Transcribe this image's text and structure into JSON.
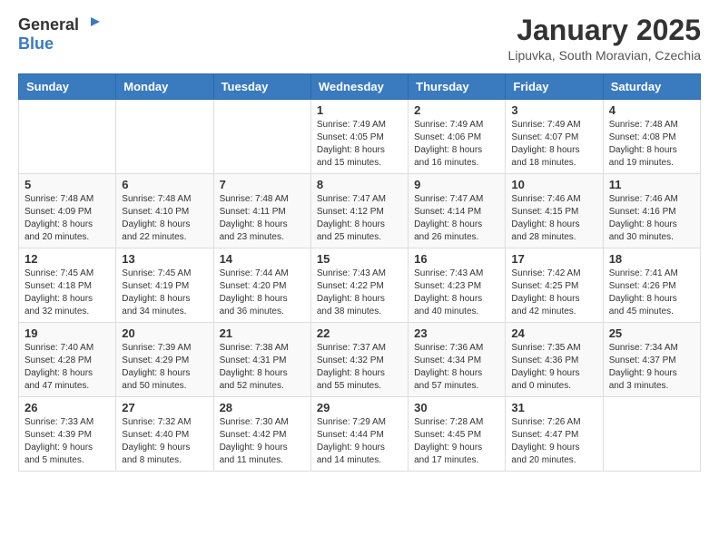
{
  "header": {
    "logo_general": "General",
    "logo_blue": "Blue",
    "month_title": "January 2025",
    "location": "Lipuvka, South Moravian, Czechia"
  },
  "days_of_week": [
    "Sunday",
    "Monday",
    "Tuesday",
    "Wednesday",
    "Thursday",
    "Friday",
    "Saturday"
  ],
  "weeks": [
    [
      {
        "num": "",
        "info": ""
      },
      {
        "num": "",
        "info": ""
      },
      {
        "num": "",
        "info": ""
      },
      {
        "num": "1",
        "info": "Sunrise: 7:49 AM\nSunset: 4:05 PM\nDaylight: 8 hours\nand 15 minutes."
      },
      {
        "num": "2",
        "info": "Sunrise: 7:49 AM\nSunset: 4:06 PM\nDaylight: 8 hours\nand 16 minutes."
      },
      {
        "num": "3",
        "info": "Sunrise: 7:49 AM\nSunset: 4:07 PM\nDaylight: 8 hours\nand 18 minutes."
      },
      {
        "num": "4",
        "info": "Sunrise: 7:48 AM\nSunset: 4:08 PM\nDaylight: 8 hours\nand 19 minutes."
      }
    ],
    [
      {
        "num": "5",
        "info": "Sunrise: 7:48 AM\nSunset: 4:09 PM\nDaylight: 8 hours\nand 20 minutes."
      },
      {
        "num": "6",
        "info": "Sunrise: 7:48 AM\nSunset: 4:10 PM\nDaylight: 8 hours\nand 22 minutes."
      },
      {
        "num": "7",
        "info": "Sunrise: 7:48 AM\nSunset: 4:11 PM\nDaylight: 8 hours\nand 23 minutes."
      },
      {
        "num": "8",
        "info": "Sunrise: 7:47 AM\nSunset: 4:12 PM\nDaylight: 8 hours\nand 25 minutes."
      },
      {
        "num": "9",
        "info": "Sunrise: 7:47 AM\nSunset: 4:14 PM\nDaylight: 8 hours\nand 26 minutes."
      },
      {
        "num": "10",
        "info": "Sunrise: 7:46 AM\nSunset: 4:15 PM\nDaylight: 8 hours\nand 28 minutes."
      },
      {
        "num": "11",
        "info": "Sunrise: 7:46 AM\nSunset: 4:16 PM\nDaylight: 8 hours\nand 30 minutes."
      }
    ],
    [
      {
        "num": "12",
        "info": "Sunrise: 7:45 AM\nSunset: 4:18 PM\nDaylight: 8 hours\nand 32 minutes."
      },
      {
        "num": "13",
        "info": "Sunrise: 7:45 AM\nSunset: 4:19 PM\nDaylight: 8 hours\nand 34 minutes."
      },
      {
        "num": "14",
        "info": "Sunrise: 7:44 AM\nSunset: 4:20 PM\nDaylight: 8 hours\nand 36 minutes."
      },
      {
        "num": "15",
        "info": "Sunrise: 7:43 AM\nSunset: 4:22 PM\nDaylight: 8 hours\nand 38 minutes."
      },
      {
        "num": "16",
        "info": "Sunrise: 7:43 AM\nSunset: 4:23 PM\nDaylight: 8 hours\nand 40 minutes."
      },
      {
        "num": "17",
        "info": "Sunrise: 7:42 AM\nSunset: 4:25 PM\nDaylight: 8 hours\nand 42 minutes."
      },
      {
        "num": "18",
        "info": "Sunrise: 7:41 AM\nSunset: 4:26 PM\nDaylight: 8 hours\nand 45 minutes."
      }
    ],
    [
      {
        "num": "19",
        "info": "Sunrise: 7:40 AM\nSunset: 4:28 PM\nDaylight: 8 hours\nand 47 minutes."
      },
      {
        "num": "20",
        "info": "Sunrise: 7:39 AM\nSunset: 4:29 PM\nDaylight: 8 hours\nand 50 minutes."
      },
      {
        "num": "21",
        "info": "Sunrise: 7:38 AM\nSunset: 4:31 PM\nDaylight: 8 hours\nand 52 minutes."
      },
      {
        "num": "22",
        "info": "Sunrise: 7:37 AM\nSunset: 4:32 PM\nDaylight: 8 hours\nand 55 minutes."
      },
      {
        "num": "23",
        "info": "Sunrise: 7:36 AM\nSunset: 4:34 PM\nDaylight: 8 hours\nand 57 minutes."
      },
      {
        "num": "24",
        "info": "Sunrise: 7:35 AM\nSunset: 4:36 PM\nDaylight: 9 hours\nand 0 minutes."
      },
      {
        "num": "25",
        "info": "Sunrise: 7:34 AM\nSunset: 4:37 PM\nDaylight: 9 hours\nand 3 minutes."
      }
    ],
    [
      {
        "num": "26",
        "info": "Sunrise: 7:33 AM\nSunset: 4:39 PM\nDaylight: 9 hours\nand 5 minutes."
      },
      {
        "num": "27",
        "info": "Sunrise: 7:32 AM\nSunset: 4:40 PM\nDaylight: 9 hours\nand 8 minutes."
      },
      {
        "num": "28",
        "info": "Sunrise: 7:30 AM\nSunset: 4:42 PM\nDaylight: 9 hours\nand 11 minutes."
      },
      {
        "num": "29",
        "info": "Sunrise: 7:29 AM\nSunset: 4:44 PM\nDaylight: 9 hours\nand 14 minutes."
      },
      {
        "num": "30",
        "info": "Sunrise: 7:28 AM\nSunset: 4:45 PM\nDaylight: 9 hours\nand 17 minutes."
      },
      {
        "num": "31",
        "info": "Sunrise: 7:26 AM\nSunset: 4:47 PM\nDaylight: 9 hours\nand 20 minutes."
      },
      {
        "num": "",
        "info": ""
      }
    ]
  ]
}
